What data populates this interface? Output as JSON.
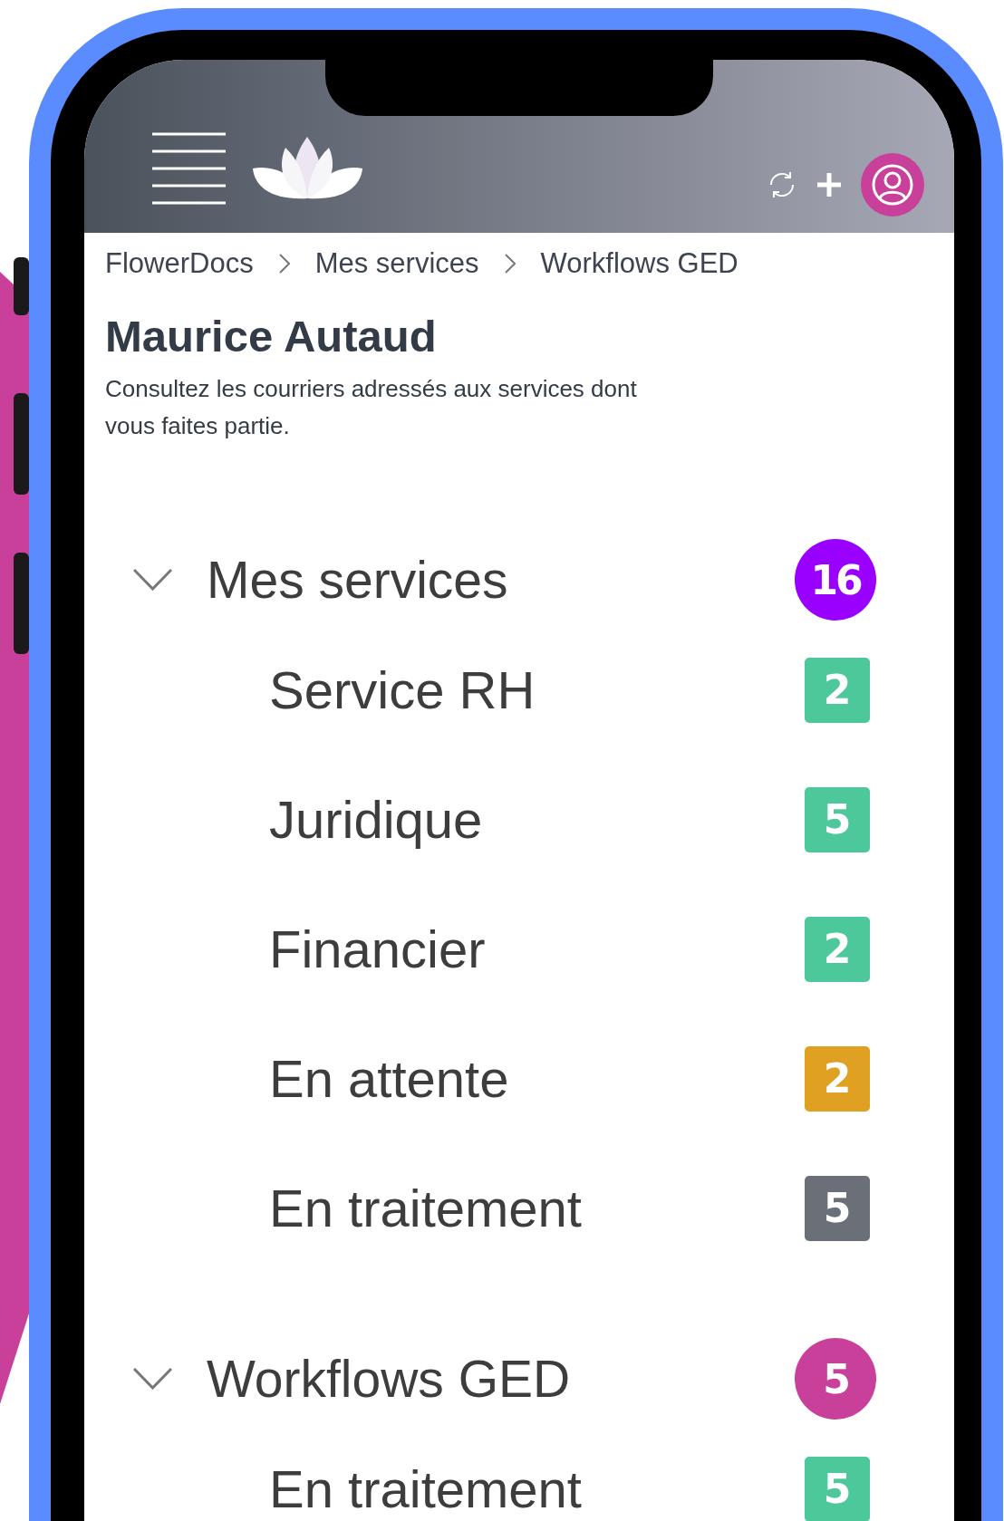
{
  "breadcrumb": [
    "FlowerDocs",
    "Mes services",
    "Workflows GED"
  ],
  "title": "Maurice Autaud",
  "description": "Consultez les courriers adressés aux services dont vous faites partie.",
  "sections": [
    {
      "label": "Mes services",
      "count": "16",
      "color": "#9900ff",
      "expanded": true,
      "children": [
        {
          "label": "Service RH",
          "count": "2",
          "color": "#4cc89a"
        },
        {
          "label": "Juridique",
          "count": "5",
          "color": "#4cc89a"
        },
        {
          "label": "Financier",
          "count": "2",
          "color": "#4cc89a"
        },
        {
          "label": "En attente",
          "count": "2",
          "color": "#e0a022"
        },
        {
          "label": "En traitement",
          "count": "5",
          "color": "#6b7078"
        }
      ]
    },
    {
      "label": "Workflows GED",
      "count": "5",
      "color": "#c8409a",
      "expanded": true,
      "children": [
        {
          "label": "En traitement",
          "count": "5",
          "color": "#4cc89a"
        }
      ]
    }
  ]
}
